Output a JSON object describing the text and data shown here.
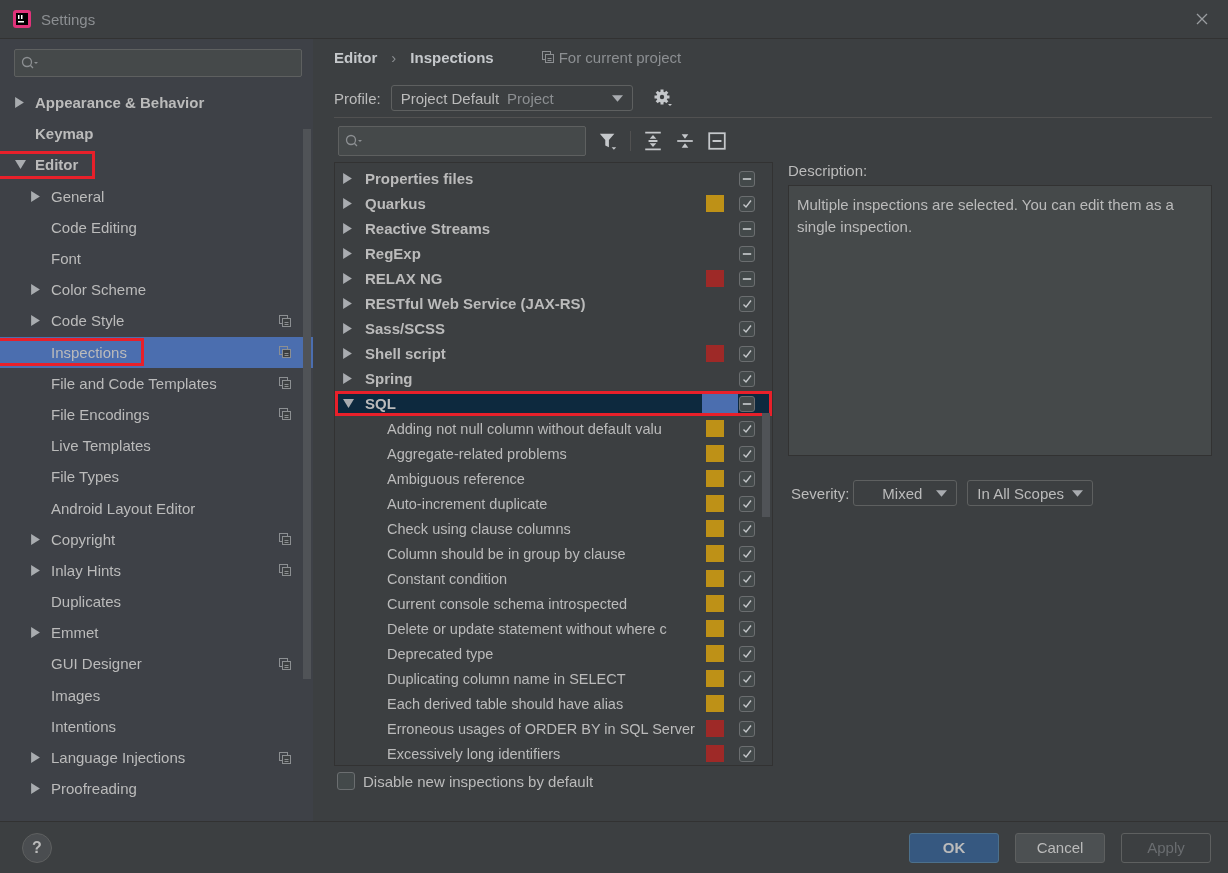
{
  "window": {
    "title": "Settings"
  },
  "sidebar": {
    "items": [
      {
        "label": "Appearance & Behavior",
        "expandable": true,
        "expanded": false,
        "selected": false
      },
      {
        "label": "Keymap",
        "selected": false
      },
      {
        "label": "Editor",
        "expandable": true,
        "expanded": true,
        "selected": false,
        "highlighted": true,
        "children": [
          {
            "label": "General",
            "expandable": true,
            "expanded": false,
            "selected": false
          },
          {
            "label": "Code Editing",
            "selected": false
          },
          {
            "label": "Font",
            "selected": false
          },
          {
            "label": "Color Scheme",
            "expandable": true,
            "expanded": false,
            "selected": false
          },
          {
            "label": "Code Style",
            "expandable": true,
            "expanded": false,
            "selected": false,
            "project_scoped": true
          },
          {
            "label": "Inspections",
            "selected": true,
            "project_scoped": true,
            "highlighted": true
          },
          {
            "label": "File and Code Templates",
            "selected": false,
            "project_scoped": true
          },
          {
            "label": "File Encodings",
            "selected": false,
            "project_scoped": true
          },
          {
            "label": "Live Templates",
            "selected": false
          },
          {
            "label": "File Types",
            "selected": false
          },
          {
            "label": "Android Layout Editor",
            "selected": false
          },
          {
            "label": "Copyright",
            "expandable": true,
            "expanded": false,
            "selected": false,
            "project_scoped": true
          },
          {
            "label": "Inlay Hints",
            "expandable": true,
            "expanded": false,
            "selected": false,
            "project_scoped": true
          },
          {
            "label": "Duplicates",
            "selected": false
          },
          {
            "label": "Emmet",
            "expandable": true,
            "expanded": false,
            "selected": false
          },
          {
            "label": "GUI Designer",
            "selected": false,
            "project_scoped": true
          },
          {
            "label": "Images",
            "selected": false
          },
          {
            "label": "Intentions",
            "selected": false
          },
          {
            "label": "Language Injections",
            "expandable": true,
            "expanded": false,
            "selected": false,
            "project_scoped": true
          },
          {
            "label": "Proofreading",
            "expandable": true,
            "expanded": false,
            "selected": false
          }
        ]
      }
    ]
  },
  "breadcrumb": {
    "parent": "Editor",
    "separator": "›",
    "current": "Inspections",
    "scope_note": "For current project"
  },
  "profile": {
    "label": "Profile:",
    "value": "Project Default",
    "value_note": "Project"
  },
  "inspections": [
    {
      "label": "Properties files",
      "expandable": true,
      "expanded": false,
      "selected": false,
      "partial": true
    },
    {
      "label": "Quarkus",
      "expandable": true,
      "expanded": false,
      "selected": false,
      "color": "#be9117",
      "checked": true
    },
    {
      "label": "Reactive Streams",
      "expandable": true,
      "expanded": false,
      "selected": false,
      "partial": true
    },
    {
      "label": "RegExp",
      "expandable": true,
      "expanded": false,
      "selected": false,
      "partial": true
    },
    {
      "label": "RELAX NG",
      "expandable": true,
      "expanded": false,
      "selected": false,
      "color": "#9e2927",
      "partial": true
    },
    {
      "label": "RESTful Web Service (JAX-RS)",
      "expandable": true,
      "expanded": false,
      "selected": false,
      "checked": true
    },
    {
      "label": "Sass/SCSS",
      "expandable": true,
      "expanded": false,
      "selected": false,
      "checked": true
    },
    {
      "label": "Shell script",
      "expandable": true,
      "expanded": false,
      "selected": false,
      "color": "#9e2927",
      "checked": true
    },
    {
      "label": "Spring",
      "expandable": true,
      "expanded": false,
      "selected": false,
      "checked": true
    },
    {
      "label": "SQL",
      "expandable": true,
      "expanded": true,
      "selected": true,
      "highlighted": true,
      "partial": true,
      "children": [
        {
          "label": "Adding not null column without default valu",
          "color": "#be9117",
          "checked": true
        },
        {
          "label": "Aggregate-related problems",
          "color": "#be9117",
          "checked": true
        },
        {
          "label": "Ambiguous reference",
          "color": "#be9117",
          "checked": true
        },
        {
          "label": "Auto-increment duplicate",
          "color": "#be9117",
          "checked": true
        },
        {
          "label": "Check using clause columns",
          "color": "#be9117",
          "checked": true
        },
        {
          "label": "Column should be in group by clause",
          "color": "#be9117",
          "checked": true
        },
        {
          "label": "Constant condition",
          "color": "#be9117",
          "checked": true
        },
        {
          "label": "Current console schema introspected",
          "color": "#be9117",
          "checked": true
        },
        {
          "label": "Delete or update statement without where c",
          "color": "#be9117",
          "checked": true
        },
        {
          "label": "Deprecated type",
          "color": "#be9117",
          "checked": true
        },
        {
          "label": "Duplicating column name in SELECT",
          "color": "#be9117",
          "checked": true
        },
        {
          "label": "Each derived table should have alias",
          "color": "#be9117",
          "checked": true
        },
        {
          "label": "Erroneous usages of ORDER BY in SQL Server",
          "color": "#9e2927",
          "checked": true
        },
        {
          "label": "Excessively long identifiers",
          "color": "#9e2927",
          "checked": true
        }
      ]
    }
  ],
  "description": {
    "label": "Description:",
    "text": "Multiple inspections are selected. You can edit them as a single inspection."
  },
  "severity": {
    "label": "Severity:",
    "value": "Mixed",
    "scope": "In All Scopes"
  },
  "disable_new": {
    "label": "Disable new inspections by default",
    "checked": false
  },
  "help": "?",
  "buttons": [
    {
      "label": "OK",
      "kind": "primary",
      "disabled": false
    },
    {
      "label": "Cancel",
      "kind": "normal",
      "disabled": false
    },
    {
      "label": "Apply",
      "kind": "normal",
      "disabled": true
    }
  ]
}
